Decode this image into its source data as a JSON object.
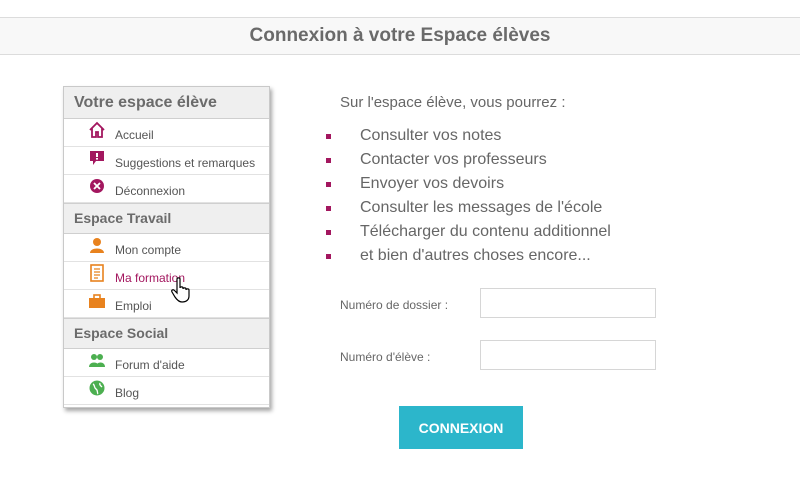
{
  "header": {
    "title": "Connexion à votre Espace élèves"
  },
  "menu": {
    "section_main": "Votre espace élève",
    "items_main": [
      {
        "label": "Accueil",
        "icon": "home-icon"
      },
      {
        "label": "Suggestions et remarques",
        "icon": "speech-bubble-icon"
      },
      {
        "label": "Déconnexion",
        "icon": "close-circle-icon"
      }
    ],
    "section_work": "Espace Travail",
    "items_work": [
      {
        "label": "Mon compte",
        "icon": "user-icon"
      },
      {
        "label": "Ma formation",
        "icon": "document-icon",
        "active": true
      },
      {
        "label": "Emploi",
        "icon": "briefcase-icon"
      }
    ],
    "section_social": "Espace Social",
    "items_social": [
      {
        "label": "Forum d'aide",
        "icon": "users-icon"
      },
      {
        "label": "Blog",
        "icon": "globe-icon"
      }
    ]
  },
  "info": {
    "intro": "Sur l'espace élève, vous pourrez :",
    "features": [
      "Consulter vos notes",
      "Contacter vos professeurs",
      "Envoyer vos devoirs",
      "Consulter les messages de l'école",
      "Télécharger du contenu additionnel",
      "et bien d'autres choses encore..."
    ]
  },
  "form": {
    "dossier_label": "Numéro de dossier :",
    "dossier_value": "",
    "eleve_label": "Numéro d'élève :",
    "eleve_value": "",
    "submit_label": "CONNEXION"
  },
  "colors": {
    "accent": "#a3175f",
    "button": "#2cb6cb",
    "orange": "#e8821e",
    "green": "#4caf50"
  }
}
